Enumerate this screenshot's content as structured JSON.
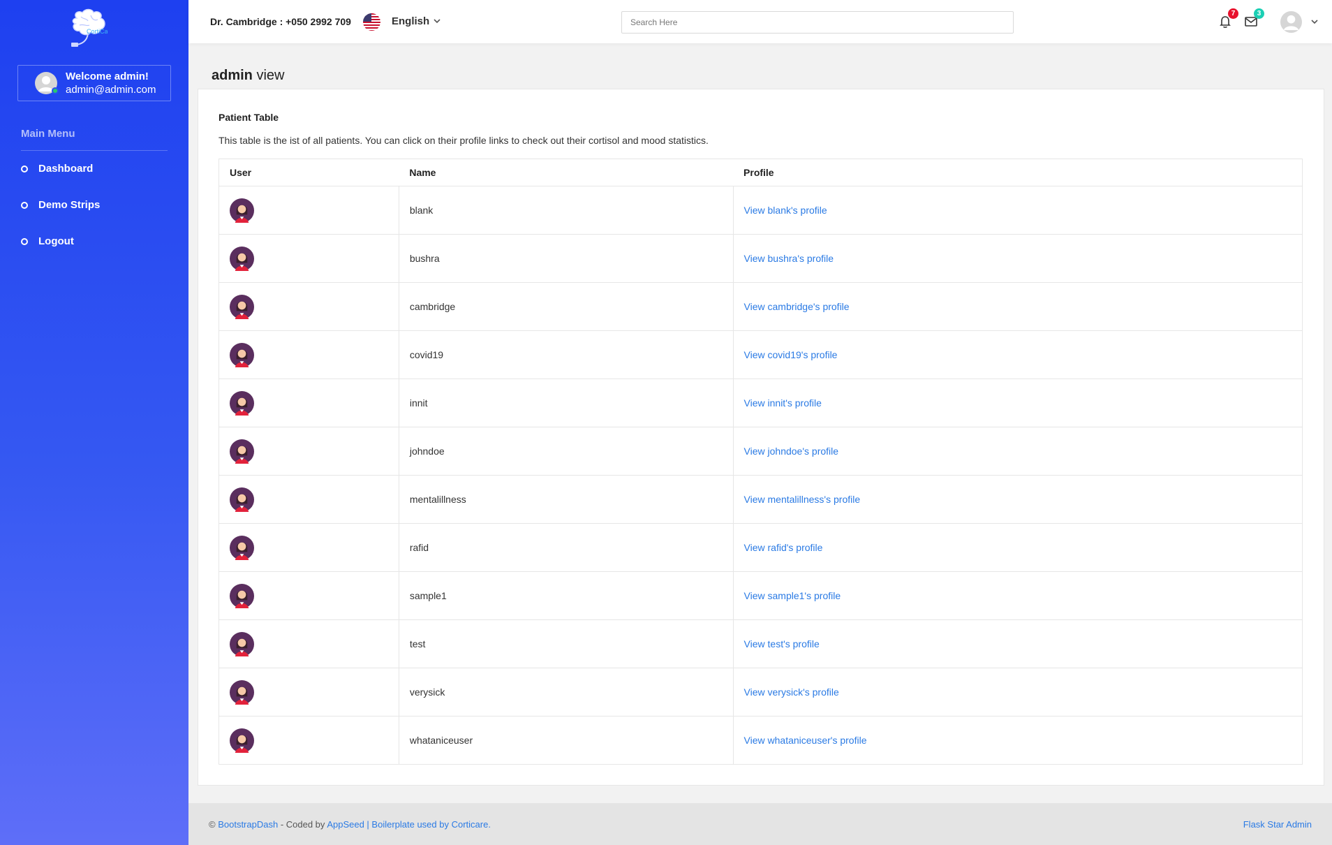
{
  "brand": {
    "logo_text": "CortiCare"
  },
  "sidebar": {
    "welcome": "Welcome admin!",
    "email": "admin@admin.com",
    "menu_title": "Main Menu",
    "items": [
      {
        "label": "Dashboard"
      },
      {
        "label": "Demo Strips"
      },
      {
        "label": "Logout"
      }
    ]
  },
  "topbar": {
    "contact": "Dr. Cambridge : +050 2992 709",
    "language": "English",
    "search_placeholder": "Search Here",
    "notifications_count": "7",
    "messages_count": "3"
  },
  "page": {
    "title_bold": "admin",
    "title_rest": " view"
  },
  "card": {
    "title": "Patient Table",
    "description": "This table is the ist of all patients. You can click on their profile links to check out their cortisol and mood statistics."
  },
  "table": {
    "headers": [
      "User",
      "Name",
      "Profile"
    ],
    "rows": [
      {
        "name": "blank",
        "link": "View blank's profile"
      },
      {
        "name": "bushra",
        "link": "View bushra's profile"
      },
      {
        "name": "cambridge",
        "link": "View cambridge's profile"
      },
      {
        "name": "covid19",
        "link": "View covid19's profile"
      },
      {
        "name": "innit",
        "link": "View innit's profile"
      },
      {
        "name": "johndoe",
        "link": "View johndoe's profile"
      },
      {
        "name": "mentalillness",
        "link": "View mentalillness's profile"
      },
      {
        "name": "rafid",
        "link": "View rafid's profile"
      },
      {
        "name": "sample1",
        "link": "View sample1's profile"
      },
      {
        "name": "test",
        "link": "View test's profile"
      },
      {
        "name": "verysick",
        "link": "View verysick's profile"
      },
      {
        "name": "whataniceuser",
        "link": "View whataniceuser's profile"
      }
    ]
  },
  "footer": {
    "copyright": "© ",
    "bootstrapdash": "BootstrapDash",
    "coded_by": " - Coded by ",
    "appseed": "AppSeed",
    "boilerplate": " | Boilerplate used by Corticare.",
    "right": "Flask Star Admin"
  },
  "colors": {
    "sidebar_top": "#1e40f0",
    "sidebar_bottom": "#5e6ef8",
    "link": "#2a7ae4",
    "notif_badge": "#e8112d",
    "msg_badge": "#1bcfb4"
  },
  "icons": {
    "notifications": "bell-icon",
    "messages": "envelope-icon",
    "language": "us-flag-icon",
    "user": "avatar-icon"
  }
}
